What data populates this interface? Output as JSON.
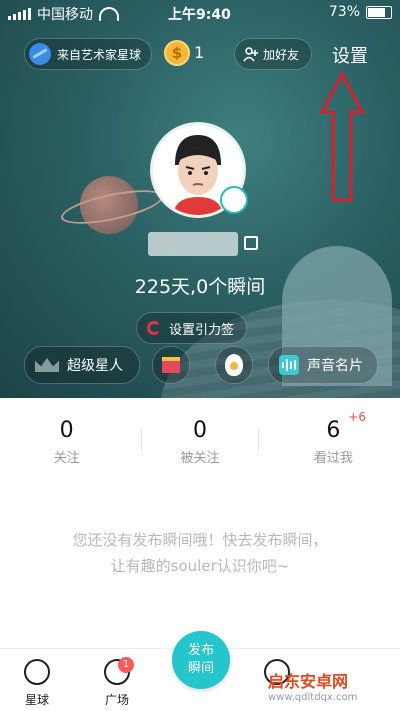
{
  "statusbar": {
    "carrier": "中国移动",
    "time": "上午9:40",
    "battery": "73%"
  },
  "header": {
    "planet_label": "来自艺术家星球",
    "coin_symbol": "$",
    "coin_count": "1",
    "add_friend": "加好友",
    "settings": "设置"
  },
  "profile": {
    "stats_line": "225天,0个瞬间",
    "tag_button": "设置引力签"
  },
  "actions": {
    "super_star": "超级星人",
    "voice_card": "声音名片"
  },
  "stats": [
    {
      "num": "0",
      "label": "关注",
      "delta": ""
    },
    {
      "num": "0",
      "label": "被关注",
      "delta": ""
    },
    {
      "num": "6",
      "label": "看过我",
      "delta": "+6"
    }
  ],
  "empty": {
    "line1": "您还没有发布瞬间哦！快去发布瞬间，",
    "line2": "让有趣的souler认识你吧~"
  },
  "tabbar": {
    "planet": "星球",
    "square": "广场",
    "square_badge": "1",
    "publish_line1": "发布",
    "publish_line2": "瞬间"
  },
  "watermark": {
    "title": "启东安卓网",
    "url": "www.qdltdqx.com"
  },
  "colors": {
    "accent": "#25c5cc",
    "hero_bg": "#2a5f62",
    "arrow": "#d8202a",
    "badge": "#ff5a5a"
  }
}
